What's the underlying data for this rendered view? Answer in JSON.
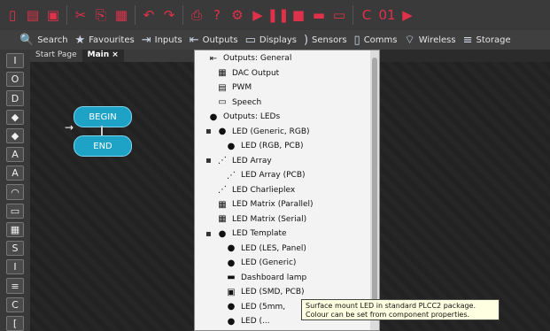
{
  "tabs": [
    "Start Page",
    "Main"
  ],
  "component_categories": [
    "Search",
    "Favourites",
    "Inputs",
    "Outputs",
    "Displays",
    "Sensors",
    "Comms",
    "Wireless",
    "Storage"
  ],
  "flowchart": {
    "begin": "BEGIN",
    "end": "END"
  },
  "dropdown": {
    "items": [
      {
        "label": "Outputs: General",
        "indent": 0,
        "icon": "folder-icon"
      },
      {
        "label": "DAC Output",
        "indent": 1,
        "icon": "dac-icon"
      },
      {
        "label": "PWM",
        "indent": 1,
        "icon": "pwm-icon"
      },
      {
        "label": "Speech",
        "indent": 1,
        "icon": "speech-icon"
      },
      {
        "label": "Outputs: LEDs",
        "indent": 0,
        "icon": "leds-folder-icon"
      },
      {
        "label": "LED (Generic, RGB)",
        "indent": 1,
        "icon": "rgb-led-icon"
      },
      {
        "label": "LED (RGB, PCB)",
        "indent": 2,
        "icon": "rgb-led-pcb-icon"
      },
      {
        "label": "LED Array",
        "indent": 1,
        "icon": "led-array-icon"
      },
      {
        "label": "LED Array (PCB)",
        "indent": 2,
        "icon": "led-array-pcb-icon"
      },
      {
        "label": "LED Charlieplex",
        "indent": 1,
        "icon": "charlieplex-icon"
      },
      {
        "label": "LED Matrix (Parallel)",
        "indent": 1,
        "icon": "matrix-icon"
      },
      {
        "label": "LED Matrix (Serial)",
        "indent": 1,
        "icon": "matrix-serial-icon"
      },
      {
        "label": "LED Template",
        "indent": 1,
        "icon": "led-template-icon"
      },
      {
        "label": "LED (LES, Panel)",
        "indent": 2,
        "icon": "led-panel-icon"
      },
      {
        "label": "LED (Generic)",
        "indent": 2,
        "icon": "led-generic-icon"
      },
      {
        "label": "Dashboard lamp",
        "indent": 2,
        "icon": "dashboard-lamp-icon"
      },
      {
        "label": "LED (SMD, PCB)",
        "indent": 2,
        "icon": "led-smd-icon"
      },
      {
        "label": "LED (5mm,",
        "indent": 2,
        "icon": "led-5mm-icon"
      },
      {
        "label": "LED (...",
        "indent": 2,
        "icon": "led-more-icon"
      }
    ]
  },
  "tooltip": "Surface mount LED in standard PLCC2 package. Colour can be set from component properties."
}
